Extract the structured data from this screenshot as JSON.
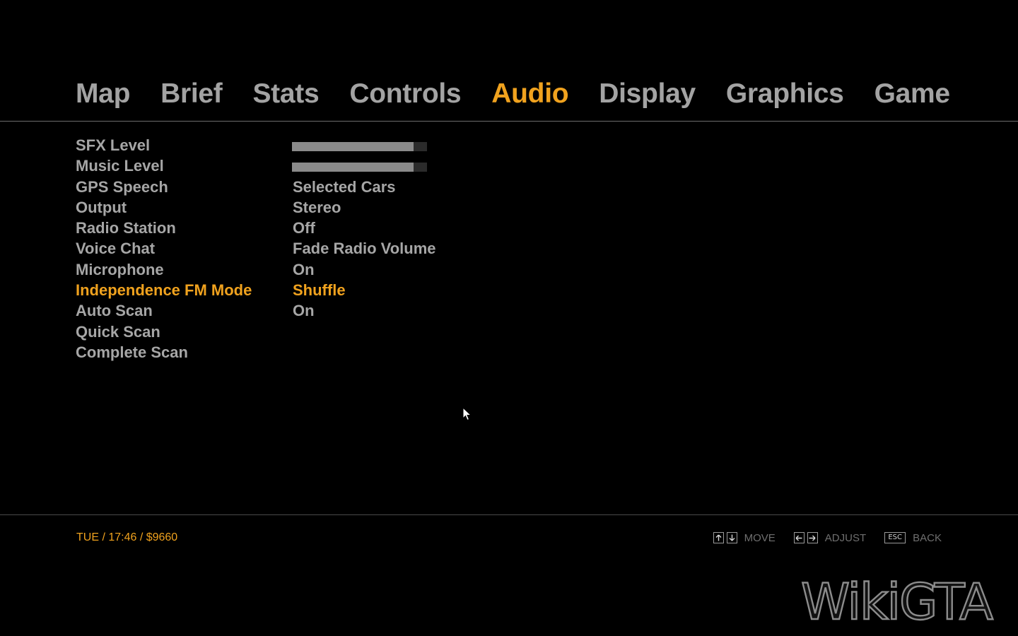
{
  "tabs": {
    "items": [
      {
        "label": "Map",
        "active": false
      },
      {
        "label": "Brief",
        "active": false
      },
      {
        "label": "Stats",
        "active": false
      },
      {
        "label": "Controls",
        "active": false
      },
      {
        "label": "Audio",
        "active": true
      },
      {
        "label": "Display",
        "active": false
      },
      {
        "label": "Graphics",
        "active": false
      },
      {
        "label": "Game",
        "active": false
      }
    ]
  },
  "settings": {
    "rows": [
      {
        "label": "SFX Level",
        "type": "slider",
        "level": 0.9
      },
      {
        "label": "Music Level",
        "type": "slider",
        "level": 0.9
      },
      {
        "label": "GPS Speech",
        "value": "Selected Cars"
      },
      {
        "label": "Output",
        "value": "Stereo"
      },
      {
        "label": "Radio Station",
        "value": "Off"
      },
      {
        "label": "Voice Chat",
        "value": "Fade Radio Volume"
      },
      {
        "label": "Microphone",
        "value": "On"
      },
      {
        "label": "Independence FM Mode",
        "value": "Shuffle",
        "selected": true
      },
      {
        "label": "Auto Scan",
        "value": "On"
      },
      {
        "label": "Quick Scan",
        "value": ""
      },
      {
        "label": "Complete Scan",
        "value": ""
      }
    ]
  },
  "status": {
    "text": "TUE  /  17:46  /  $9660"
  },
  "hints": {
    "move_label": "MOVE",
    "adjust_label": "ADJUST",
    "back_key": "ESC",
    "back_label": "BACK"
  },
  "watermark": {
    "text": "WikiGTA"
  },
  "colors": {
    "accent": "#f0a21e",
    "text": "#a6a6a6",
    "background": "#000000"
  },
  "icons": {
    "up": "arrow-up-icon",
    "down": "arrow-down-icon",
    "left": "arrow-left-icon",
    "right": "arrow-right-icon",
    "cursor": "mouse-cursor-icon"
  }
}
